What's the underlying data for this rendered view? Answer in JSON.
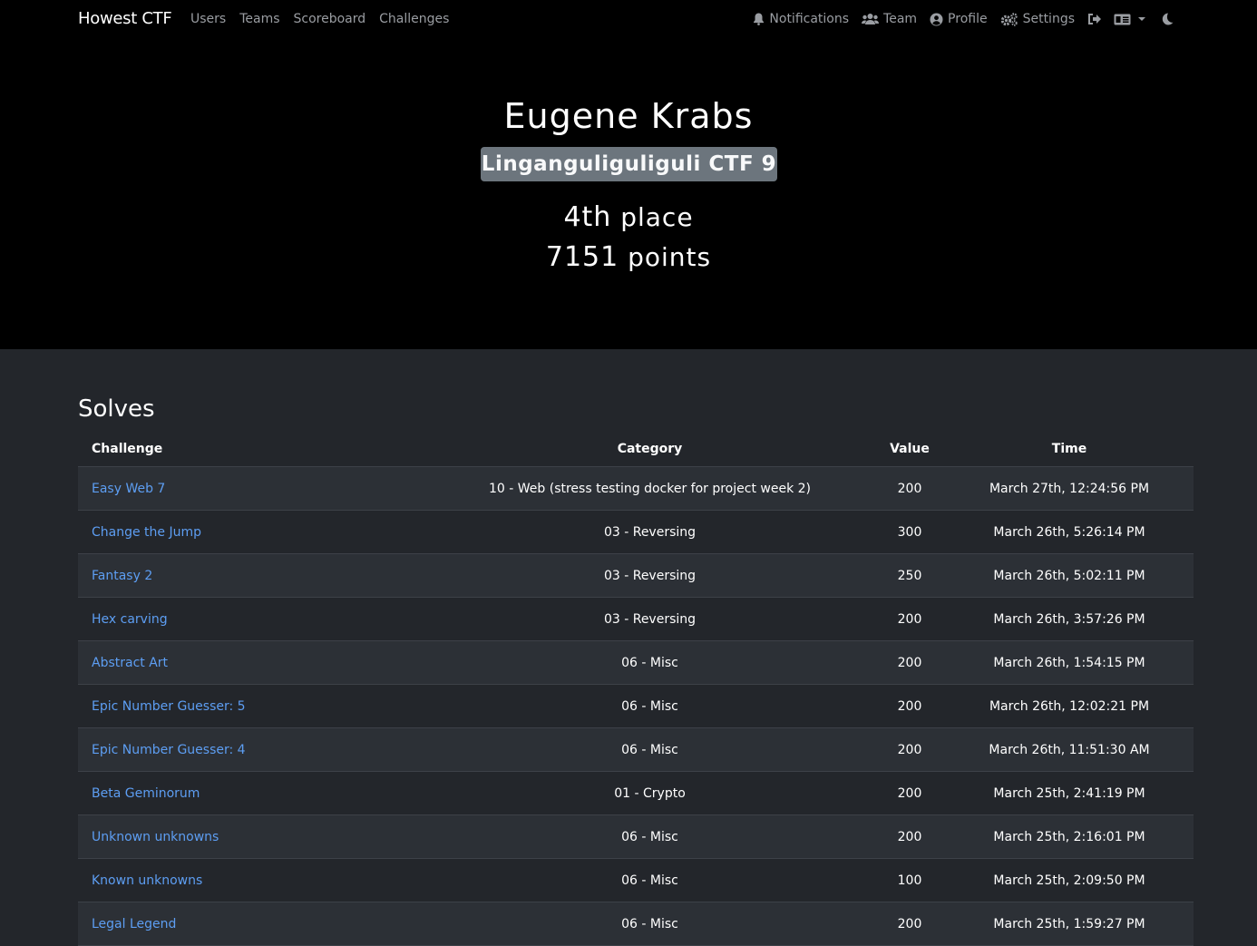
{
  "nav": {
    "brand": "Howest CTF",
    "left": [
      "Users",
      "Teams",
      "Scoreboard",
      "Challenges"
    ],
    "notifications": "Notifications",
    "team": "Team",
    "profile": "Profile",
    "settings": "Settings"
  },
  "profile": {
    "name": "Eugene Krabs",
    "team": "Linganguliguliguli CTF 9",
    "place_num": "4th",
    "place_word": "place",
    "points_num": "7151",
    "points_word": "points"
  },
  "solves": {
    "title": "Solves",
    "headers": [
      "Challenge",
      "Category",
      "Value",
      "Time"
    ],
    "rows": [
      {
        "challenge": "Easy Web 7",
        "category": "10 - Web (stress testing docker for project week 2)",
        "value": "200",
        "time": "March 27th, 12:24:56 PM"
      },
      {
        "challenge": "Change the Jump",
        "category": "03 - Reversing",
        "value": "300",
        "time": "March 26th, 5:26:14 PM"
      },
      {
        "challenge": "Fantasy 2",
        "category": "03 - Reversing",
        "value": "250",
        "time": "March 26th, 5:02:11 PM"
      },
      {
        "challenge": "Hex carving",
        "category": "03 - Reversing",
        "value": "200",
        "time": "March 26th, 3:57:26 PM"
      },
      {
        "challenge": "Abstract Art",
        "category": "06 - Misc",
        "value": "200",
        "time": "March 26th, 1:54:15 PM"
      },
      {
        "challenge": "Epic Number Guesser: 5",
        "category": "06 - Misc",
        "value": "200",
        "time": "March 26th, 12:02:21 PM"
      },
      {
        "challenge": "Epic Number Guesser: 4",
        "category": "06 - Misc",
        "value": "200",
        "time": "March 26th, 11:51:30 AM"
      },
      {
        "challenge": "Beta Geminorum",
        "category": "01 - Crypto",
        "value": "200",
        "time": "March 25th, 2:41:19 PM"
      },
      {
        "challenge": "Unknown unknowns",
        "category": "06 - Misc",
        "value": "200",
        "time": "March 25th, 2:16:01 PM"
      },
      {
        "challenge": "Known unknowns",
        "category": "06 - Misc",
        "value": "100",
        "time": "March 25th, 2:09:50 PM"
      },
      {
        "challenge": "Legal Legend",
        "category": "06 - Misc",
        "value": "200",
        "time": "March 25th, 1:59:27 PM"
      }
    ]
  }
}
